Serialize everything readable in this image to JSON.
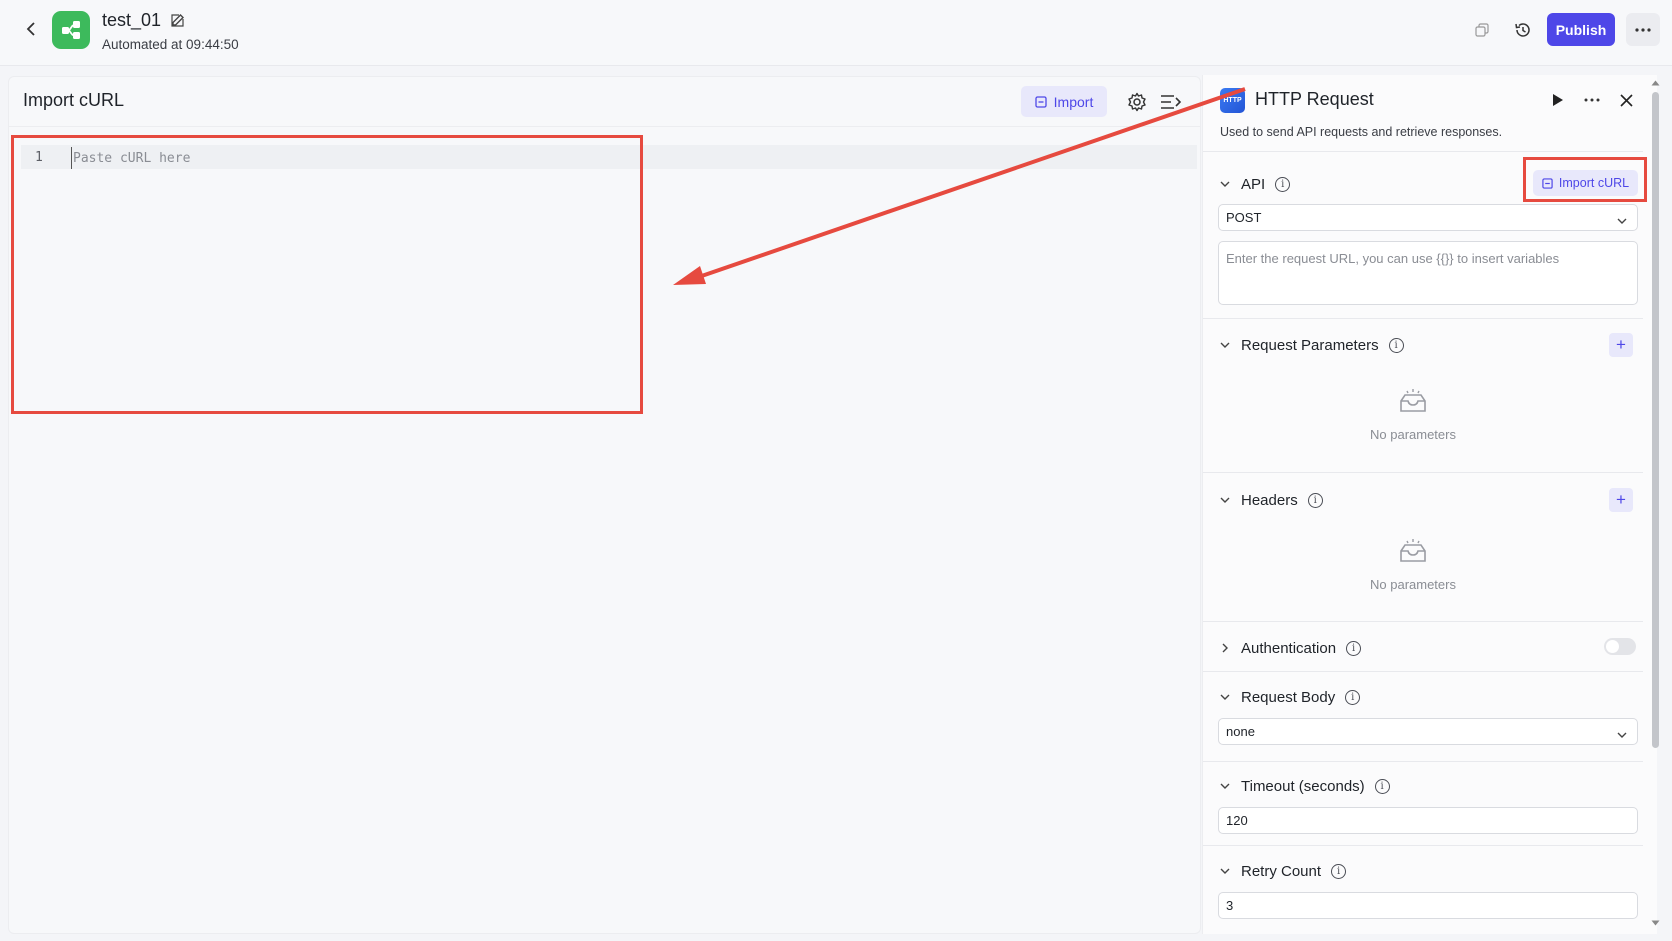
{
  "header": {
    "title": "test_01",
    "subtitle": "Automated at 09:44:50",
    "publish_label": "Publish"
  },
  "left_panel": {
    "title": "Import cURL",
    "import_label": "Import",
    "editor": {
      "line_number": "1",
      "placeholder": "Paste cURL here",
      "value": ""
    }
  },
  "right_panel": {
    "title": "HTTP Request",
    "logo_text": "HTTP",
    "description": "Used to send API requests and retrieve responses.",
    "api": {
      "label": "API",
      "import_curl_label": "Import cURL",
      "method": "POST",
      "url_placeholder": "Enter the request URL, you can use {{}} to insert variables"
    },
    "request_parameters": {
      "label": "Request Parameters",
      "empty_text": "No parameters"
    },
    "headers": {
      "label": "Headers",
      "empty_text": "No parameters"
    },
    "authentication": {
      "label": "Authentication",
      "enabled": false
    },
    "request_body": {
      "label": "Request Body",
      "value": "none"
    },
    "timeout": {
      "label": "Timeout (seconds)",
      "value": "120"
    },
    "retry": {
      "label": "Retry Count",
      "value": "3"
    }
  },
  "colors": {
    "accent": "#4e47e8",
    "annotation_red": "#e64a3f",
    "app_icon_green": "#3dba5c"
  }
}
